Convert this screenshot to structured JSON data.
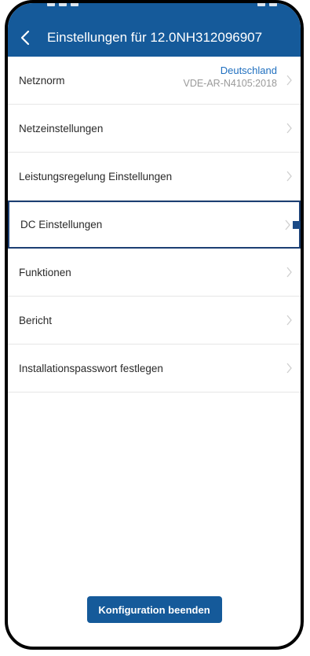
{
  "header": {
    "title": "Einstellungen für 12.0NH312096907",
    "back_icon": "chevron-left-icon"
  },
  "colors": {
    "primary": "#155a9a",
    "accent_text": "#1f6fbf",
    "secondary_text": "#9a9a9a",
    "highlight_border": "#1c3f73"
  },
  "menu": {
    "items": [
      {
        "label": "Netznorm",
        "value_country": "Deutschland",
        "value_norm": "VDE-AR-N4105:2018"
      },
      {
        "label": "Netzeinstellungen"
      },
      {
        "label": "Leistungsregelung Einstellungen"
      },
      {
        "label": "DC Einstellungen",
        "highlighted": true
      },
      {
        "label": "Funktionen"
      },
      {
        "label": "Bericht"
      },
      {
        "label": "Installationspasswort festlegen"
      }
    ]
  },
  "footer": {
    "finish_label": "Konfiguration beenden"
  }
}
